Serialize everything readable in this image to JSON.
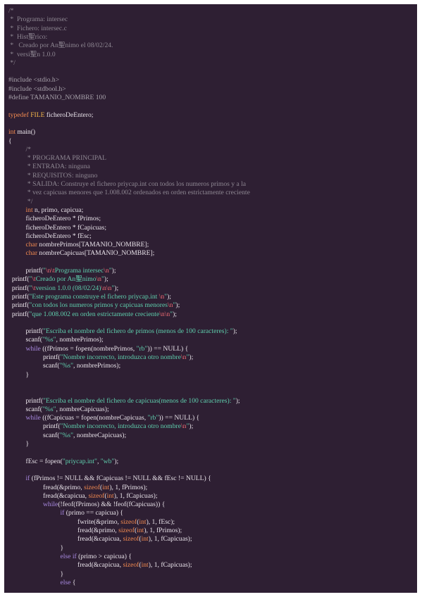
{
  "document": {
    "language": "c",
    "lines": [
      {
        "x": 0,
        "s": [
          [
            "/*",
            "comment"
          ]
        ]
      },
      {
        "x": 0,
        "s": [
          [
            " *  Programa: intersec",
            "comment"
          ]
        ]
      },
      {
        "x": 0,
        "s": [
          [
            " *  Fichero: intersec.c",
            "comment"
          ]
        ]
      },
      {
        "x": 0,
        "s": [
          [
            " *  Hist",
            "comment"
          ],
          [
            "聖",
            "comment"
          ],
          [
            "rico:",
            "comment"
          ]
        ]
      },
      {
        "x": 0,
        "s": [
          [
            " *   Creado por An",
            "comment"
          ],
          [
            "聖",
            "comment"
          ],
          [
            "nimo el 08/02/24.",
            "comment"
          ]
        ]
      },
      {
        "x": 0,
        "s": [
          [
            " *  versi",
            "comment"
          ],
          [
            "聖",
            "comment"
          ],
          [
            "n 1.0.0",
            "comment"
          ]
        ]
      },
      {
        "x": 0,
        "s": [
          [
            " */",
            "comment"
          ]
        ]
      },
      {
        "x": 0,
        "s": []
      },
      {
        "x": 0,
        "s": [
          [
            "#include <stdio.h>",
            "prep"
          ]
        ]
      },
      {
        "x": 0,
        "s": [
          [
            "#include <stdbool.h>",
            "prep"
          ]
        ]
      },
      {
        "x": 0,
        "s": [
          [
            "#define TAMANIO_NOMBRE 100",
            "prep"
          ]
        ]
      },
      {
        "x": 0,
        "s": []
      },
      {
        "x": 0,
        "s": [
          [
            "typedef",
            "kw"
          ],
          [
            " ",
            "plain"
          ],
          [
            "FILE",
            "type"
          ],
          [
            " ficheroDeEntero;",
            "plain"
          ]
        ]
      },
      {
        "x": 0,
        "s": []
      },
      {
        "x": 0,
        "s": [
          [
            "int",
            "kw"
          ],
          [
            " ",
            "plain"
          ],
          [
            "main",
            "fn"
          ],
          [
            "()",
            "plain"
          ]
        ]
      },
      {
        "x": 0,
        "s": [
          [
            "{",
            "plain"
          ]
        ]
      },
      {
        "x": 1,
        "s": [
          [
            "/*",
            "comment"
          ]
        ]
      },
      {
        "x": 1,
        "s": [
          [
            " * PROGRAMA PRINCIPAL",
            "comment"
          ]
        ]
      },
      {
        "x": 1,
        "s": [
          [
            " * ENTRADA: ninguna",
            "comment"
          ]
        ]
      },
      {
        "x": 1,
        "s": [
          [
            " * REQUISITOS: ninguno",
            "comment"
          ]
        ]
      },
      {
        "x": 1,
        "s": [
          [
            " * SALIDA: Construye el fichero priycap.int con todos los numeros primos y a la",
            "comment"
          ]
        ]
      },
      {
        "x": 1,
        "s": [
          [
            " * vez capicuas menores que 1.008.002 ordenados en orden estrictamente creciente",
            "comment"
          ]
        ]
      },
      {
        "x": 1,
        "s": [
          [
            " */",
            "comment"
          ]
        ]
      },
      {
        "x": 1,
        "s": [
          [
            "int",
            "kw"
          ],
          [
            " n, primo, capicua;",
            "plain"
          ]
        ]
      },
      {
        "x": 1,
        "s": [
          [
            "ficheroDeEntero ",
            "plain"
          ],
          [
            "*",
            "op"
          ],
          [
            " fPrimos;",
            "plain"
          ]
        ]
      },
      {
        "x": 1,
        "s": [
          [
            "ficheroDeEntero ",
            "plain"
          ],
          [
            "*",
            "op"
          ],
          [
            " fCapicuas;",
            "plain"
          ]
        ]
      },
      {
        "x": 1,
        "s": [
          [
            "ficheroDeEntero ",
            "plain"
          ],
          [
            "*",
            "op"
          ],
          [
            " fEsc;",
            "plain"
          ]
        ]
      },
      {
        "x": 1,
        "s": [
          [
            "char",
            "kw"
          ],
          [
            " nombrePrimos[TAMANIO_NOMBRE];",
            "plain"
          ]
        ]
      },
      {
        "x": 1,
        "s": [
          [
            "char",
            "kw"
          ],
          [
            " nombreCapicuas[TAMANIO_NOMBRE];",
            "plain"
          ]
        ]
      },
      {
        "x": 0,
        "s": []
      },
      {
        "x": 1,
        "s": [
          [
            "printf",
            "fn"
          ],
          [
            "(",
            "plain"
          ],
          [
            "\"",
            "str"
          ],
          [
            "\\n\\t",
            "esc"
          ],
          [
            "Programa intersec",
            "str"
          ],
          [
            "\\n",
            "esc"
          ],
          [
            "\"",
            "str"
          ],
          [
            ");",
            "plain"
          ]
        ]
      },
      {
        "x": 0.2,
        "s": [
          [
            "printf",
            "fn"
          ],
          [
            "(",
            "plain"
          ],
          [
            "\"",
            "str"
          ],
          [
            "\\t",
            "esc"
          ],
          [
            "Creado por An",
            "str"
          ],
          [
            "聖",
            "str"
          ],
          [
            "nimo",
            "str"
          ],
          [
            "\\n",
            "esc"
          ],
          [
            "\"",
            "str"
          ],
          [
            ");",
            "plain"
          ]
        ]
      },
      {
        "x": 0.2,
        "s": [
          [
            "printf",
            "fn"
          ],
          [
            "(",
            "plain"
          ],
          [
            "\"",
            "str"
          ],
          [
            "\\t",
            "esc"
          ],
          [
            "version 1.0.0 (08/02/24)",
            "str"
          ],
          [
            "\\n\\n",
            "esc"
          ],
          [
            "\"",
            "str"
          ],
          [
            ");",
            "plain"
          ]
        ]
      },
      {
        "x": 0.2,
        "s": [
          [
            "printf",
            "fn"
          ],
          [
            "(",
            "plain"
          ],
          [
            "\"Este programa construye el fichero priycap.int ",
            "str"
          ],
          [
            "\\n",
            "esc"
          ],
          [
            "\"",
            "str"
          ],
          [
            ");",
            "plain"
          ]
        ]
      },
      {
        "x": 0.2,
        "s": [
          [
            "printf",
            "fn"
          ],
          [
            "(",
            "plain"
          ],
          [
            "\"con todos los numeros primos y capicuas menores",
            "str"
          ],
          [
            "\\n",
            "esc"
          ],
          [
            "\"",
            "str"
          ],
          [
            ");",
            "plain"
          ]
        ]
      },
      {
        "x": 0.2,
        "s": [
          [
            "printf",
            "fn"
          ],
          [
            "(",
            "plain"
          ],
          [
            "\"que 1.008.002 en orden estrictamente creciente",
            "str"
          ],
          [
            "\\n\\n",
            "esc"
          ],
          [
            "\"",
            "str"
          ],
          [
            ");",
            "plain"
          ]
        ]
      },
      {
        "x": 0,
        "s": []
      },
      {
        "x": 1,
        "s": [
          [
            "printf",
            "fn"
          ],
          [
            "(",
            "plain"
          ],
          [
            "\"Escriba el nombre del fichero de primos (menos de 100 caracteres): \"",
            "str"
          ],
          [
            ");",
            "plain"
          ]
        ]
      },
      {
        "x": 1,
        "s": [
          [
            "scanf",
            "fn"
          ],
          [
            "(",
            "plain"
          ],
          [
            "\"%s\"",
            "str"
          ],
          [
            ", nombrePrimos);",
            "plain"
          ]
        ]
      },
      {
        "x": 1,
        "s": [
          [
            "while",
            "ctrl"
          ],
          [
            " ((fPrimos ",
            "plain"
          ],
          [
            "=",
            "op"
          ],
          [
            " fopen(nombrePrimos, ",
            "plain"
          ],
          [
            "\"rb\"",
            "str"
          ],
          [
            ")) ",
            "plain"
          ],
          [
            "==",
            "op"
          ],
          [
            " NULL) {",
            "plain"
          ]
        ]
      },
      {
        "x": 2,
        "s": [
          [
            "printf",
            "fn"
          ],
          [
            "(",
            "plain"
          ],
          [
            "\"Nombre incorrecto, introduzca otro nombre",
            "str"
          ],
          [
            "\\n",
            "esc"
          ],
          [
            "\"",
            "str"
          ],
          [
            ");",
            "plain"
          ]
        ]
      },
      {
        "x": 2,
        "s": [
          [
            "scanf",
            "fn"
          ],
          [
            "(",
            "plain"
          ],
          [
            "\"%s\"",
            "str"
          ],
          [
            ", nombrePrimos);",
            "plain"
          ]
        ]
      },
      {
        "x": 1,
        "s": [
          [
            "}",
            "plain"
          ]
        ]
      },
      {
        "x": 0,
        "s": []
      },
      {
        "x": 0,
        "s": []
      },
      {
        "x": 1,
        "s": [
          [
            "printf",
            "fn"
          ],
          [
            "(",
            "plain"
          ],
          [
            "\"Escriba el nombre del fichero de capicuas(menos de 100 caracteres): \"",
            "str"
          ],
          [
            ");",
            "plain"
          ]
        ]
      },
      {
        "x": 1,
        "s": [
          [
            "scanf",
            "fn"
          ],
          [
            "(",
            "plain"
          ],
          [
            "\"%s\"",
            "str"
          ],
          [
            ", nombreCapicuas);",
            "plain"
          ]
        ]
      },
      {
        "x": 1,
        "s": [
          [
            "while",
            "ctrl"
          ],
          [
            " ((fCapicuas ",
            "plain"
          ],
          [
            "=",
            "op"
          ],
          [
            " fopen(nombreCapicuas, ",
            "plain"
          ],
          [
            "\"rb\"",
            "str"
          ],
          [
            ")) ",
            "plain"
          ],
          [
            "==",
            "op"
          ],
          [
            " NULL) {",
            "plain"
          ]
        ]
      },
      {
        "x": 2,
        "s": [
          [
            "printf",
            "fn"
          ],
          [
            "(",
            "plain"
          ],
          [
            "\"Nombre incorrecto, introduzca otro nombre",
            "str"
          ],
          [
            "\\n",
            "esc"
          ],
          [
            "\"",
            "str"
          ],
          [
            ");",
            "plain"
          ]
        ]
      },
      {
        "x": 2,
        "s": [
          [
            "scanf",
            "fn"
          ],
          [
            "(",
            "plain"
          ],
          [
            "\"%s\"",
            "str"
          ],
          [
            ", nombreCapicuas);",
            "plain"
          ]
        ]
      },
      {
        "x": 1,
        "s": [
          [
            "}",
            "plain"
          ]
        ]
      },
      {
        "x": 0,
        "s": []
      },
      {
        "x": 1,
        "s": [
          [
            "fEsc ",
            "plain"
          ],
          [
            "=",
            "op"
          ],
          [
            " fopen(",
            "plain"
          ],
          [
            "\"priycap.int\"",
            "str"
          ],
          [
            ", ",
            "plain"
          ],
          [
            "\"wb\"",
            "str"
          ],
          [
            ");",
            "plain"
          ]
        ]
      },
      {
        "x": 0,
        "s": []
      },
      {
        "x": 1,
        "s": [
          [
            "if",
            "ctrl"
          ],
          [
            " (fPrimos ",
            "plain"
          ],
          [
            "!=",
            "op"
          ],
          [
            " NULL ",
            "plain"
          ],
          [
            "&&",
            "op"
          ],
          [
            " fCapicuas ",
            "plain"
          ],
          [
            "!=",
            "op"
          ],
          [
            " NULL ",
            "plain"
          ],
          [
            "&&",
            "op"
          ],
          [
            " fEsc ",
            "plain"
          ],
          [
            "!=",
            "op"
          ],
          [
            " NULL) {",
            "plain"
          ]
        ]
      },
      {
        "x": 2,
        "s": [
          [
            "fread(",
            "plain"
          ],
          [
            "&",
            "op"
          ],
          [
            "primo, ",
            "plain"
          ],
          [
            "sizeof",
            "kw"
          ],
          [
            "(",
            "plain"
          ],
          [
            "int",
            "kw"
          ],
          [
            "), 1, fPrimos);",
            "plain"
          ]
        ]
      },
      {
        "x": 2,
        "s": [
          [
            "fread(",
            "plain"
          ],
          [
            "&",
            "op"
          ],
          [
            "capicua, ",
            "plain"
          ],
          [
            "sizeof",
            "kw"
          ],
          [
            "(",
            "plain"
          ],
          [
            "int",
            "kw"
          ],
          [
            "), 1, fCapicuas);",
            "plain"
          ]
        ]
      },
      {
        "x": 2,
        "s": [
          [
            "while",
            "ctrl"
          ],
          [
            "(",
            "plain"
          ],
          [
            "!",
            "op"
          ],
          [
            "feof(fPrimos) ",
            "plain"
          ],
          [
            "&&",
            "op"
          ],
          [
            " ",
            "plain"
          ],
          [
            "!",
            "op"
          ],
          [
            "feof(fCapicuas)) {",
            "plain"
          ]
        ]
      },
      {
        "x": 3,
        "s": [
          [
            "if",
            "ctrl"
          ],
          [
            " (primo ",
            "plain"
          ],
          [
            "==",
            "op"
          ],
          [
            " capicua) {",
            "plain"
          ]
        ]
      },
      {
        "x": 4,
        "s": [
          [
            "fwrite(",
            "plain"
          ],
          [
            "&",
            "op"
          ],
          [
            "primo, ",
            "plain"
          ],
          [
            "sizeof",
            "kw"
          ],
          [
            "(",
            "plain"
          ],
          [
            "int",
            "kw"
          ],
          [
            "), 1, fEsc);",
            "plain"
          ]
        ]
      },
      {
        "x": 4,
        "s": [
          [
            "fread(",
            "plain"
          ],
          [
            "&",
            "op"
          ],
          [
            "primo, ",
            "plain"
          ],
          [
            "sizeof",
            "kw"
          ],
          [
            "(",
            "plain"
          ],
          [
            "int",
            "kw"
          ],
          [
            "), 1, fPrimos);",
            "plain"
          ]
        ]
      },
      {
        "x": 4,
        "s": [
          [
            "fread(",
            "plain"
          ],
          [
            "&",
            "op"
          ],
          [
            "capicua, ",
            "plain"
          ],
          [
            "sizeof",
            "kw"
          ],
          [
            "(",
            "plain"
          ],
          [
            "int",
            "kw"
          ],
          [
            "), 1, fCapicuas);",
            "plain"
          ]
        ]
      },
      {
        "x": 3,
        "s": [
          [
            "}",
            "plain"
          ]
        ]
      },
      {
        "x": 3,
        "s": [
          [
            "else",
            "ctrl"
          ],
          [
            " ",
            "plain"
          ],
          [
            "if",
            "ctrl"
          ],
          [
            " (primo ",
            "plain"
          ],
          [
            ">",
            "op"
          ],
          [
            " capicua) {",
            "plain"
          ]
        ]
      },
      {
        "x": 4,
        "s": [
          [
            "fread(",
            "plain"
          ],
          [
            "&",
            "op"
          ],
          [
            "capicua, ",
            "plain"
          ],
          [
            "sizeof",
            "kw"
          ],
          [
            "(",
            "plain"
          ],
          [
            "int",
            "kw"
          ],
          [
            "), 1, fCapicuas);",
            "plain"
          ]
        ]
      },
      {
        "x": 3,
        "s": [
          [
            "}",
            "plain"
          ]
        ]
      },
      {
        "x": 3,
        "s": [
          [
            "else",
            "ctrl"
          ],
          [
            " {",
            "plain"
          ]
        ]
      }
    ]
  }
}
